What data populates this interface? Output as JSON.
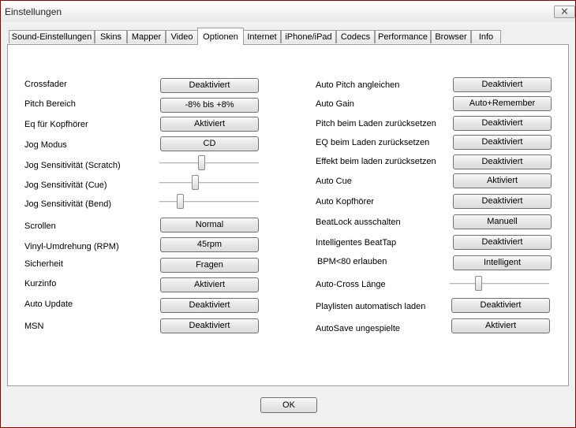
{
  "window": {
    "title": "Einstellungen",
    "close_label": "✕"
  },
  "tabs": [
    {
      "label": "Sound-Einstellungen",
      "active": false
    },
    {
      "label": "Skins",
      "active": false
    },
    {
      "label": "Mapper",
      "active": false
    },
    {
      "label": "Video",
      "active": false
    },
    {
      "label": "Optionen",
      "active": true
    },
    {
      "label": "Internet",
      "active": false
    },
    {
      "label": "iPhone/iPad",
      "active": false
    },
    {
      "label": "Codecs",
      "active": false
    },
    {
      "label": "Performance",
      "active": false
    },
    {
      "label": "Browser",
      "active": false
    },
    {
      "label": "Info",
      "active": false
    }
  ],
  "left": {
    "crossfader": {
      "label": "Crossfader",
      "value": "Deaktiviert"
    },
    "pitch_range": {
      "label": "Pitch Bereich",
      "value": "-8% bis +8%"
    },
    "eq_headphones": {
      "label": "Eq für Kopfhörer",
      "value": "Aktiviert"
    },
    "jog_mode": {
      "label": "Jog Modus",
      "value": "CD"
    },
    "jog_scratch": {
      "label": "Jog Sensitivität (Scratch)",
      "level": 0.42
    },
    "jog_cue": {
      "label": "Jog Sensitivität (Cue)",
      "level": 0.35
    },
    "jog_bend": {
      "label": "Jog Sensitivität (Bend)",
      "level": 0.19
    },
    "scroll": {
      "label": "Scrollen",
      "value": "Normal"
    },
    "vinyl_rpm": {
      "label": "Vinyl-Umdrehung (RPM)",
      "value": "45rpm"
    },
    "security": {
      "label": "Sicherheit",
      "value": "Fragen"
    },
    "tooltip": {
      "label": "Kurzinfo",
      "value": "Aktiviert"
    },
    "auto_update": {
      "label": "Auto Update",
      "value": "Deaktiviert"
    },
    "msn": {
      "label": "MSN",
      "value": "Deaktiviert"
    }
  },
  "right": {
    "auto_pitch": {
      "label": "Auto Pitch angleichen",
      "value": "Deaktiviert"
    },
    "auto_gain": {
      "label": "Auto Gain",
      "value": "Auto+Remember"
    },
    "pitch_reset": {
      "label": "Pitch beim Laden zurücksetzen",
      "value": "Deaktiviert"
    },
    "eq_reset": {
      "label": "EQ beim Laden zurücksetzen",
      "value": "Deaktiviert"
    },
    "effect_reset": {
      "label": "Effekt beim laden zurücksetzen",
      "value": "Deaktiviert"
    },
    "auto_cue": {
      "label": "Auto Cue",
      "value": "Aktiviert"
    },
    "auto_headphones": {
      "label": "Auto Kopfhörer",
      "value": "Deaktiviert"
    },
    "beatlock_off": {
      "label": "BeatLock ausschalten",
      "value": "Manuell"
    },
    "smart_beattap": {
      "label": "Intelligentes BeatTap",
      "value": "Deaktiviert"
    },
    "bpm80": {
      "label": "BPM<80 erlauben",
      "value": "Intelligent"
    },
    "autocross_length": {
      "label": "Auto-Cross Länge",
      "level": 0.27
    },
    "playlist_autoload": {
      "label": "Playlisten automatisch laden",
      "value": "Deaktiviert"
    },
    "autosave_unplayed": {
      "label": "AutoSave ungespielte",
      "value": "Aktiviert"
    }
  },
  "footer": {
    "ok_label": "OK"
  }
}
